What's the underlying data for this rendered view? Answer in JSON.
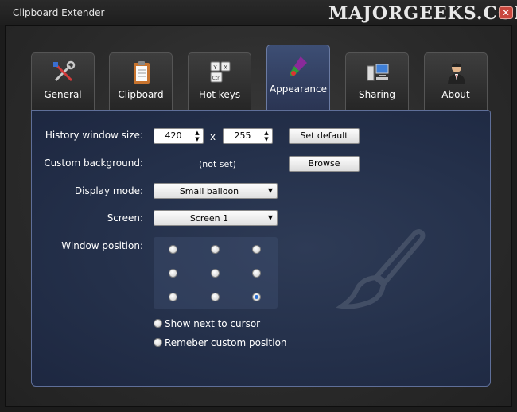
{
  "window": {
    "title": "Clipboard Extender",
    "watermark": "MAJORGEEKS.COM",
    "close_symbol": "✕"
  },
  "tabs": [
    {
      "label": "General",
      "icon": "tools-icon",
      "active": false
    },
    {
      "label": "Clipboard",
      "icon": "clipboard-icon",
      "active": false
    },
    {
      "label": "Hot keys",
      "icon": "keyboard-keys-icon",
      "active": false
    },
    {
      "label": "Appearance",
      "icon": "paint-brush-icon",
      "active": true
    },
    {
      "label": "Sharing",
      "icon": "network-computers-icon",
      "active": false
    },
    {
      "label": "About",
      "icon": "person-icon",
      "active": false
    }
  ],
  "appearance": {
    "history_size_label": "History window size:",
    "width_value": "420",
    "height_value": "255",
    "size_separator": "x",
    "set_default_label": "Set default",
    "custom_bg_label": "Custom background:",
    "custom_bg_value": "(not set)",
    "browse_label": "Browse",
    "display_mode_label": "Display mode:",
    "display_mode_value": "Small balloon",
    "screen_label": "Screen:",
    "screen_value": "Screen 1",
    "window_position_label": "Window position:",
    "position_grid_selected": "bottom-right",
    "show_next_label": "Show next to cursor",
    "remember_label": "Remeber custom position"
  },
  "colors": {
    "panel_bg": "#24304a",
    "active_tab": "#3d4e74",
    "radio_selected": "#2b6fd0"
  }
}
